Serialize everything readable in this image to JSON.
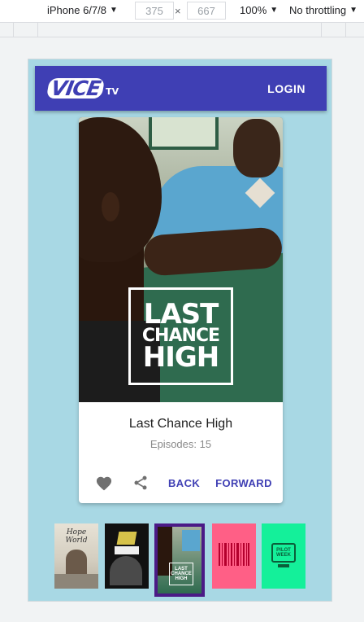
{
  "devtools": {
    "device": "iPhone 6/7/8",
    "width": "375",
    "times": "×",
    "height": "667",
    "zoom": "100%",
    "throttle": "No throttling"
  },
  "appbar": {
    "logo_main": "VICE",
    "logo_sub": "TV",
    "login_label": "LOGIN"
  },
  "card": {
    "poster_line1": "LAST",
    "poster_line2": "CHANCE",
    "poster_line3": "HIGH",
    "title": "Last Chance High",
    "episodes": "Episodes: 15",
    "back_label": "BACK",
    "forward_label": "FORWARD"
  },
  "thumbnails": {
    "th1_text": "Hope World",
    "th3_text": "LAST CHANCE HIGH",
    "th5_text": "PILOT WEEK"
  },
  "colors": {
    "appbar": "#3f3fb4",
    "background": "#a8d8e4",
    "accent": "#3f3fb4",
    "selected_border": "#4b1a86"
  }
}
